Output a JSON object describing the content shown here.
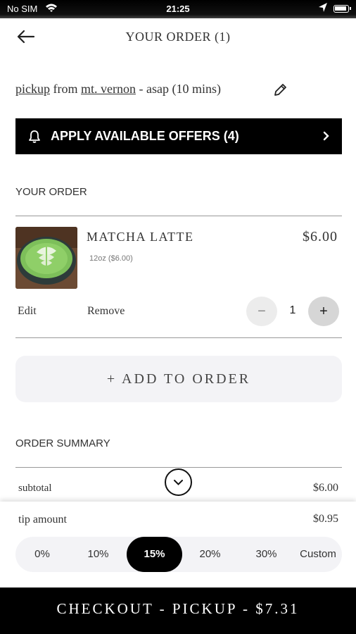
{
  "status_bar": {
    "carrier": "No SIM",
    "time": "21:25"
  },
  "header": {
    "title": "YOUR ORDER (1)",
    "back_icon": "arrow-left-icon"
  },
  "pickup": {
    "mode": "pickup",
    "from": "from",
    "location": "mt. vernon",
    "timing": "- asap (10 mins)",
    "edit_icon": "pencil-icon"
  },
  "offers": {
    "label": "APPLY AVAILABLE OFFERS (4)",
    "icon": "bell-icon"
  },
  "order_section": {
    "title": "YOUR ORDER"
  },
  "item": {
    "name": "MATCHA LATTE",
    "price": "$6.00",
    "size": "12oz ($6.00)",
    "edit_label": "Edit",
    "remove_label": "Remove",
    "quantity": "1",
    "minus": "−",
    "plus": "+"
  },
  "add_to_order": "+ ADD TO ORDER",
  "summary": {
    "title": "ORDER SUMMARY",
    "subtotal_label": "subtotal",
    "subtotal_value": "$6.00",
    "tip_label": "tip amount",
    "tip_value": "$0.95"
  },
  "tip_options": [
    "0%",
    "10%",
    "15%",
    "20%",
    "30%",
    "Custom"
  ],
  "tip_selected": "15%",
  "checkout": {
    "label": "CHECKOUT - PICKUP - $7.31"
  },
  "colors": {
    "accent": "#000000",
    "surface": "#f3f3f6",
    "text": "#333333"
  }
}
